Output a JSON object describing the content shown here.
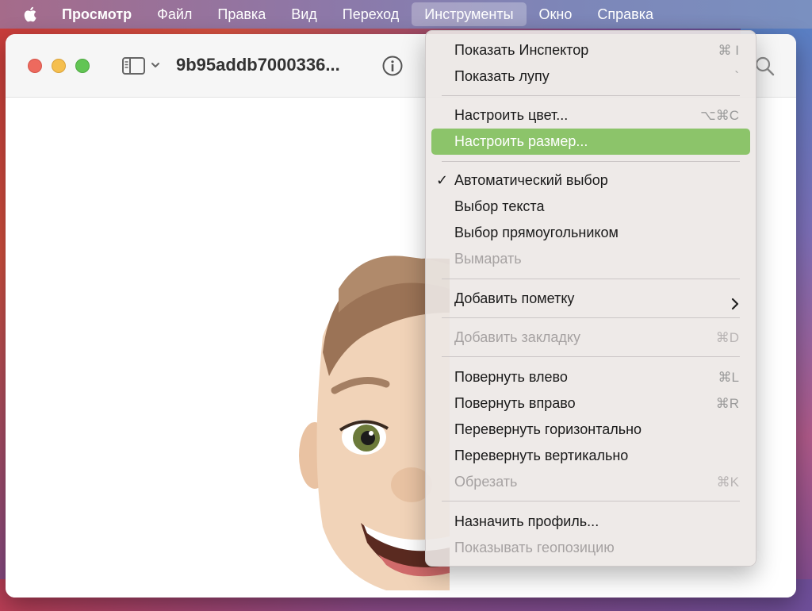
{
  "menubar": {
    "app": "Просмотр",
    "items": [
      "Файл",
      "Правка",
      "Вид",
      "Переход",
      "Инструменты",
      "Окно",
      "Справка"
    ],
    "active_index": 4
  },
  "window": {
    "title": "9b95addb7000336..."
  },
  "menu": {
    "items": [
      {
        "label": "Показать Инспектор",
        "shortcut": "⌘ I"
      },
      {
        "label": "Показать лупу",
        "shortcut": "`"
      },
      {
        "label": "Настроить цвет...",
        "shortcut": "⌥⌘C"
      },
      {
        "label": "Настроить размер...",
        "shortcut": "",
        "highlighted": true
      },
      {
        "label": "Автоматический выбор",
        "shortcut": "",
        "checked": true
      },
      {
        "label": "Выбор текста",
        "shortcut": ""
      },
      {
        "label": "Выбор прямоугольником",
        "shortcut": ""
      },
      {
        "label": "Вымарать",
        "shortcut": "",
        "disabled": true
      },
      {
        "label": "Добавить пометку",
        "shortcut": "",
        "submenu": true
      },
      {
        "label": "Добавить закладку",
        "shortcut": "⌘D",
        "disabled": true
      },
      {
        "label": "Повернуть влево",
        "shortcut": "⌘L"
      },
      {
        "label": "Повернуть вправо",
        "shortcut": "⌘R"
      },
      {
        "label": "Перевернуть горизонтально",
        "shortcut": ""
      },
      {
        "label": "Перевернуть вертикально",
        "shortcut": ""
      },
      {
        "label": "Обрезать",
        "shortcut": "⌘K",
        "disabled": true
      },
      {
        "label": "Назначить профиль...",
        "shortcut": ""
      },
      {
        "label": "Показывать геопозицию",
        "shortcut": "",
        "disabled": true
      }
    ]
  },
  "colors": {
    "highlight": "#8cc46a",
    "close": "#ed6a5e",
    "minimize": "#f5bf4f",
    "zoom": "#62c554"
  },
  "icons": [
    "apple-icon",
    "sidebar-icon",
    "chevron-down-icon",
    "info-icon",
    "search-icon",
    "checkmark-icon",
    "chevron-right-icon"
  ]
}
